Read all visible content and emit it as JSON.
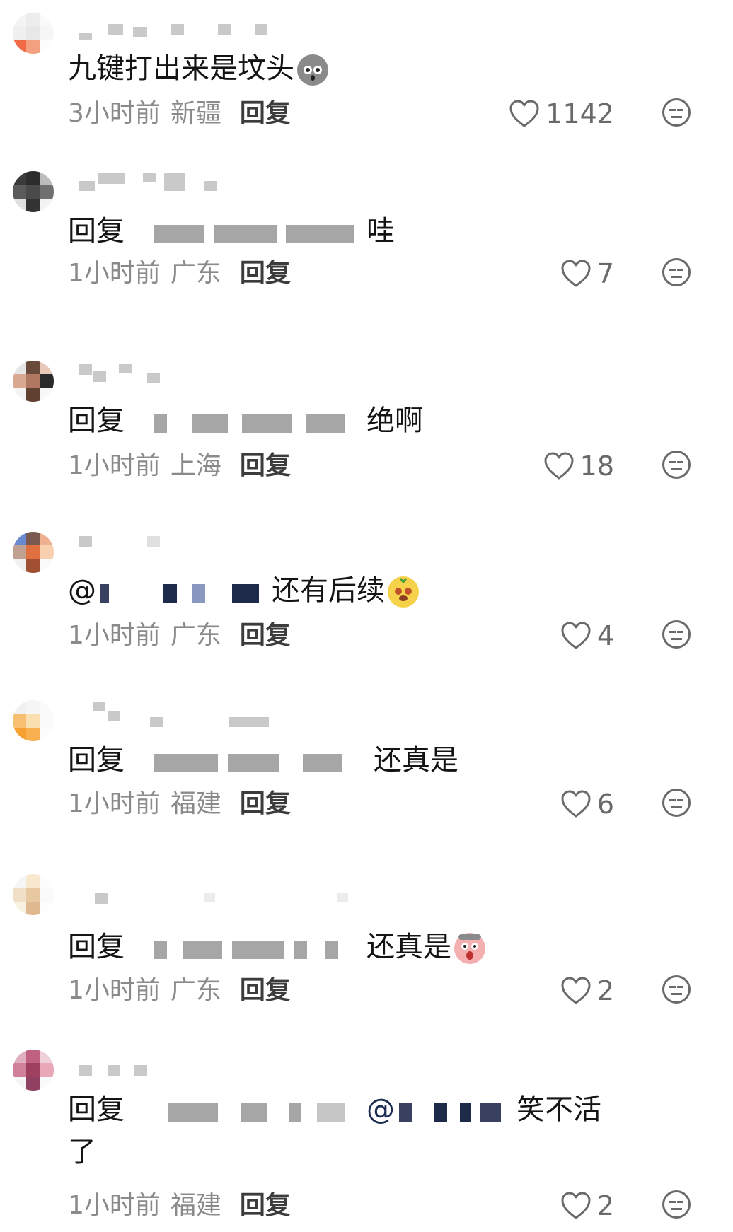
{
  "comments": [
    {
      "text": "九键打出来是坟头",
      "time": "3小时前",
      "location": "新疆",
      "reply_label": "回复",
      "likes": "1142",
      "emoji_icon": "stone-face-emoji"
    },
    {
      "prefix": "回复",
      "text": "哇",
      "time": "1小时前",
      "location": "广东",
      "reply_label": "回复",
      "likes": "7"
    },
    {
      "prefix": "回复",
      "text": "绝啊",
      "time": "1小时前",
      "location": "上海",
      "reply_label": "回复",
      "likes": "18"
    },
    {
      "prefix": "@",
      "text": "还有后续",
      "time": "1小时前",
      "location": "广东",
      "reply_label": "回复",
      "likes": "4",
      "emoji_icon": "yellow-face-emoji"
    },
    {
      "prefix": "回复",
      "text": "还真是",
      "time": "1小时前",
      "location": "福建",
      "reply_label": "回复",
      "likes": "6"
    },
    {
      "prefix": "回复",
      "text": "还真是",
      "time": "1小时前",
      "location": "广东",
      "reply_label": "回复",
      "likes": "2",
      "emoji_icon": "scream-face-emoji"
    },
    {
      "prefix": "回复",
      "mention": "@",
      "text": "笑不活",
      "text_line2": "了",
      "time": "1小时前",
      "location": "福建",
      "reply_label": "回复",
      "likes": "2"
    }
  ],
  "colors": {
    "meta_text": "#8a8a8a",
    "reply_text": "#3c3c3c",
    "icon": "#6a6a6a",
    "redaction": "#a6a6a6"
  }
}
